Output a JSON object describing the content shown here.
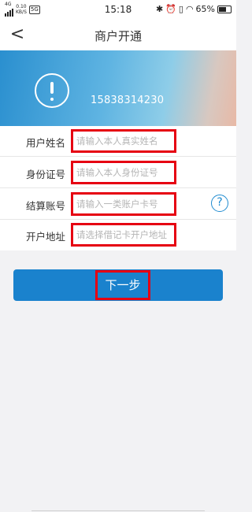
{
  "status_bar": {
    "network": "4G",
    "speed": "0.10",
    "speed_unit": "KB/S",
    "extra_icon": "5G",
    "time": "15:18",
    "battery": "65%",
    "battery_level": 0.65,
    "icons": [
      "bluetooth-icon",
      "alarm-icon",
      "vibrate-icon",
      "wifi-icon",
      "battery-icon"
    ]
  },
  "nav": {
    "back_icon": "<",
    "title": "商户开通"
  },
  "banner": {
    "phone": "15838314230",
    "icon": "exclamation-icon"
  },
  "form": {
    "fields": [
      {
        "label": "用户姓名",
        "placeholder": "请输入本人真实姓名"
      },
      {
        "label": "身份证号",
        "placeholder": "请输入本人身份证号"
      },
      {
        "label": "结算账号",
        "placeholder": "请输入一类账户卡号"
      },
      {
        "label": "开户地址",
        "placeholder": "请选择借记卡开户地址"
      }
    ],
    "help_icon": "?"
  },
  "actions": {
    "next_label": "下一步"
  },
  "colors": {
    "primary": "#1a82cd",
    "highlight": "#e60012"
  }
}
